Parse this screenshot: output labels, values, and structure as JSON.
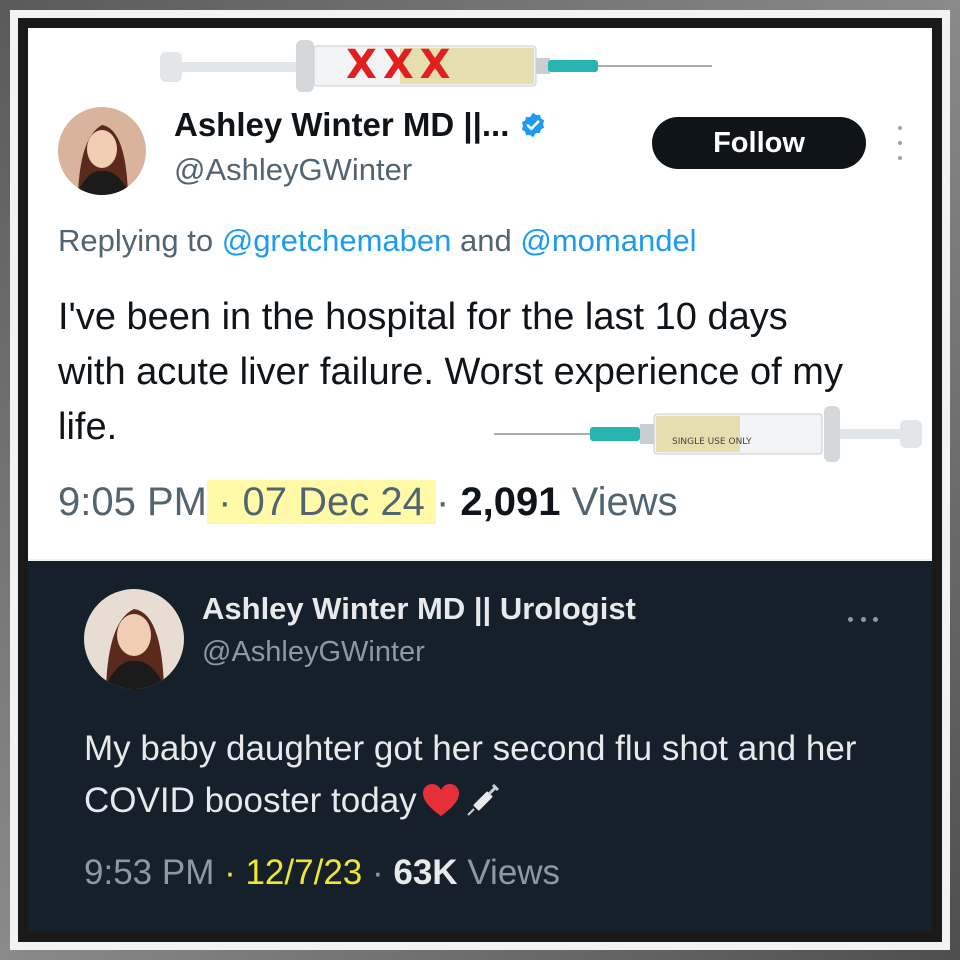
{
  "top_tweet": {
    "display_name": "Ashley Winter MD ||...",
    "handle": "@AshleyGWinter",
    "follow_label": "Follow",
    "reply_prefix": "Replying to",
    "reply_mention_1": "@gretchemaben",
    "reply_and": "and",
    "reply_mention_2": "@momandel",
    "body": "I've been in the hospital for the last 10 days with acute liver failure. Worst experience of my life.",
    "time": "9:05 PM",
    "date": "07 Dec 24",
    "views_count": "2,091",
    "views_label": "Views",
    "overlay_marks": "XXX",
    "syringe_label": "SINGLE USE ONLY"
  },
  "bottom_tweet": {
    "display_name": "Ashley Winter MD || Urologist",
    "handle": "@AshleyGWinter",
    "body": "My baby daughter got her second flu shot and her COVID booster today",
    "time": "9:53 PM",
    "date": "12/7/23",
    "views_count": "63K",
    "views_label": "Views"
  },
  "colors": {
    "verified": "#1d9bf0",
    "highlight_light": "#fffaa8",
    "highlight_dark": "#f0e632",
    "dark_bg": "#15202b",
    "x_marks": "#e21e1e"
  },
  "icons": [
    "verified-badge-icon",
    "more-vertical-icon",
    "more-horizontal-icon",
    "red-heart-icon",
    "syringe-icon"
  ]
}
